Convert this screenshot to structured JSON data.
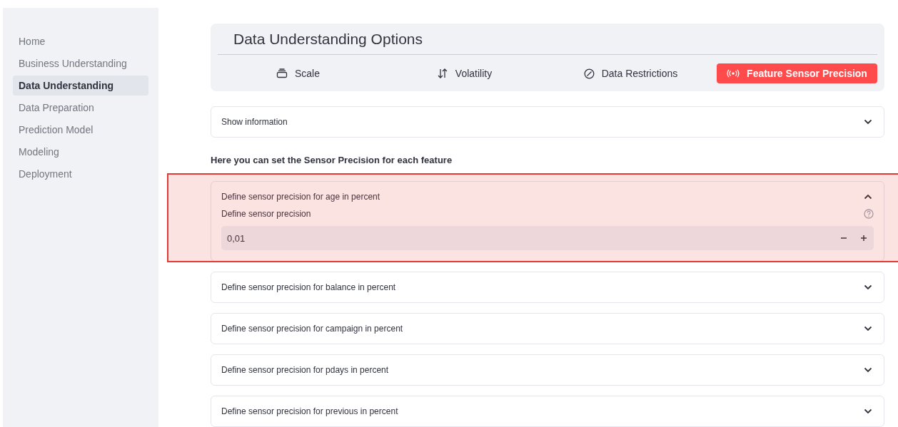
{
  "sidebar": {
    "items": [
      {
        "label": "Home",
        "selected": false
      },
      {
        "label": "Business Understanding",
        "selected": false
      },
      {
        "label": "Data Understanding",
        "selected": true
      },
      {
        "label": "Data Preparation",
        "selected": false
      },
      {
        "label": "Prediction Model",
        "selected": false
      },
      {
        "label": "Modeling",
        "selected": false
      },
      {
        "label": "Deployment",
        "selected": false
      }
    ]
  },
  "options": {
    "title": "Data Understanding Options",
    "tabs": [
      {
        "label": "Scale",
        "kind": "scale",
        "selected": false
      },
      {
        "label": "Volatility",
        "kind": "volatility",
        "selected": false
      },
      {
        "label": "Data Restrictions",
        "kind": "restrictions",
        "selected": false
      },
      {
        "label": "Feature Sensor Precision",
        "kind": "sensor",
        "selected": true
      }
    ]
  },
  "info": {
    "label": "Show information",
    "expanded": false
  },
  "heading": "Here you can set the Sensor Precision for each feature",
  "expanders": [
    {
      "label": "Define sensor precision for age in percent",
      "expanded": true,
      "highlighted": true,
      "field": {
        "label": "Define sensor precision",
        "value": "0,01"
      }
    },
    {
      "label": "Define sensor precision for balance in percent",
      "expanded": false,
      "highlighted": false
    },
    {
      "label": "Define sensor precision for campaign in percent",
      "expanded": false,
      "highlighted": false
    },
    {
      "label": "Define sensor precision for pdays in percent",
      "expanded": false,
      "highlighted": false
    },
    {
      "label": "Define sensor precision for previous in percent",
      "expanded": false,
      "highlighted": false
    }
  ]
}
